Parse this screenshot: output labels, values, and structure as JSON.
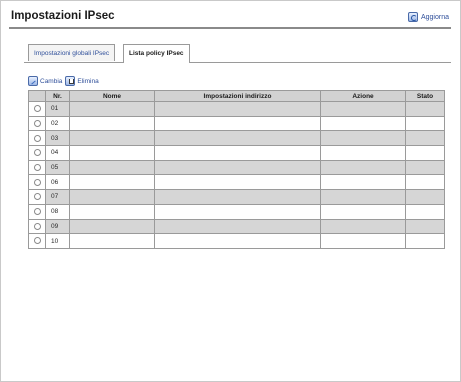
{
  "header": {
    "title": "Impostazioni IPsec",
    "refresh_label": "Aggiorna",
    "refresh_icon": "refresh-icon"
  },
  "tabs": [
    {
      "label": "Impostazioni globali IPsec",
      "active": false
    },
    {
      "label": "Lista policy IPsec",
      "active": true
    }
  ],
  "toolbar": {
    "edit_label": "Cambia",
    "edit_icon": "edit-icon",
    "delete_label": "Elimina",
    "delete_icon": "delete-icon"
  },
  "table": {
    "columns": [
      "",
      "Nr.",
      "Nome",
      "Impostazioni indirizzo",
      "Azione",
      "Stato"
    ],
    "rows": [
      {
        "nr": "01",
        "name": "",
        "address": "",
        "action": "",
        "status": ""
      },
      {
        "nr": "02",
        "name": "",
        "address": "",
        "action": "",
        "status": ""
      },
      {
        "nr": "03",
        "name": "",
        "address": "",
        "action": "",
        "status": ""
      },
      {
        "nr": "04",
        "name": "",
        "address": "",
        "action": "",
        "status": ""
      },
      {
        "nr": "05",
        "name": "",
        "address": "",
        "action": "",
        "status": ""
      },
      {
        "nr": "06",
        "name": "",
        "address": "",
        "action": "",
        "status": ""
      },
      {
        "nr": "07",
        "name": "",
        "address": "",
        "action": "",
        "status": ""
      },
      {
        "nr": "08",
        "name": "",
        "address": "",
        "action": "",
        "status": ""
      },
      {
        "nr": "09",
        "name": "",
        "address": "",
        "action": "",
        "status": ""
      },
      {
        "nr": "10",
        "name": "",
        "address": "",
        "action": "",
        "status": ""
      }
    ]
  },
  "colors": {
    "link": "#2f4f9a",
    "header_row": "#d2d2d2",
    "shaded_row": "#d6d6d6",
    "border": "#9a9a9a"
  }
}
